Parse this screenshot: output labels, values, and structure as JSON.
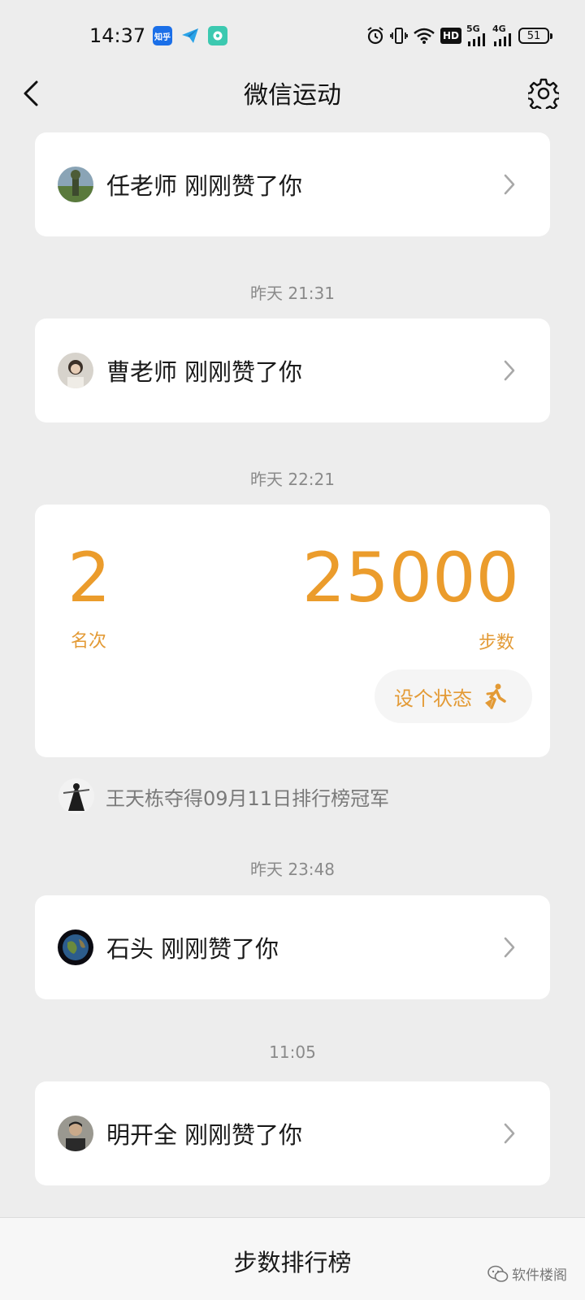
{
  "status_bar": {
    "time": "14:37",
    "app_icons": [
      "zhihu-icon",
      "paper-plane-icon",
      "chat-bubble-icon"
    ],
    "zhihu_label": "知乎",
    "hd_label": "HD",
    "net1_label": "5G",
    "net2_label": "4G",
    "battery": "51"
  },
  "nav": {
    "title": "微信运动"
  },
  "items": [
    {
      "name": "任老师",
      "text": "刚刚赞了你"
    },
    {
      "time": "昨天 21:31"
    },
    {
      "name": "曹老师",
      "text": "刚刚赞了你"
    },
    {
      "time": "昨天 22:21"
    }
  ],
  "rank_card": {
    "rank": "2",
    "rank_label": "名次",
    "steps": "25000",
    "steps_label": "步数",
    "status_button": "设个状态"
  },
  "champion": {
    "text": "王天栋夺得09月11日排行榜冠军"
  },
  "later": [
    {
      "time": "昨天 23:48",
      "name": "石头",
      "text": "刚刚赞了你"
    },
    {
      "time": "11:05",
      "name": "明开全",
      "text": "刚刚赞了你"
    }
  ],
  "bottom": {
    "leaderboard": "步数排行榜",
    "watermark": "软件楼阁"
  },
  "colors": {
    "accent": "#eb9c2c",
    "background": "#ededed",
    "card": "#ffffff"
  }
}
